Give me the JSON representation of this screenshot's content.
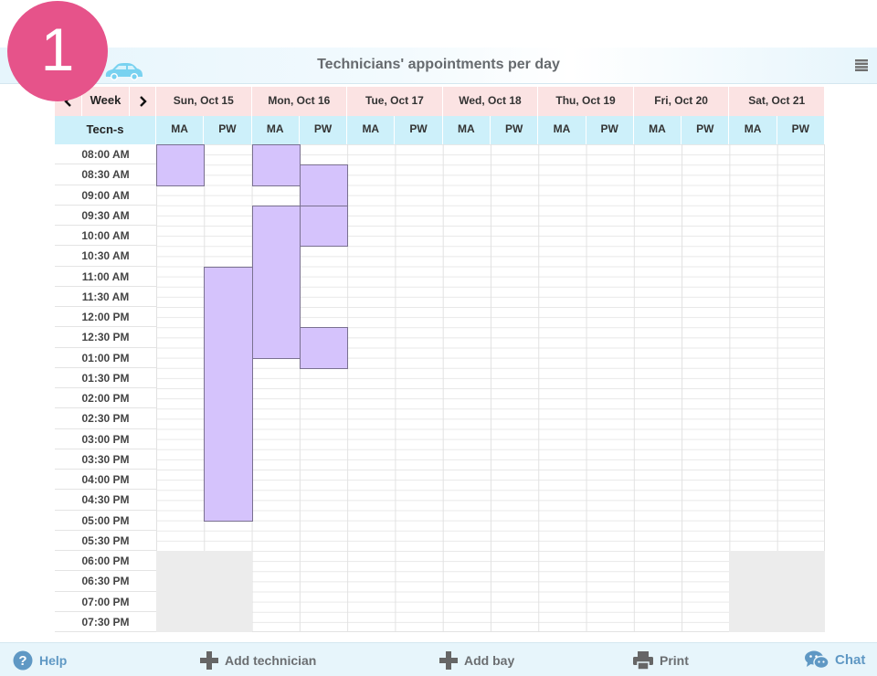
{
  "step_number": "1",
  "header": {
    "title": "Technicians' appointments per day",
    "logo_icon": "car-icon",
    "menu_icon": "menu-icon"
  },
  "calendar": {
    "week_label": "Week",
    "tech_label": "Tecn-s",
    "days": [
      {
        "label": "Sun, Oct 15",
        "techs": [
          "MA",
          "PW"
        ]
      },
      {
        "label": "Mon, Oct 16",
        "techs": [
          "MA",
          "PW"
        ]
      },
      {
        "label": "Tue, Oct 17",
        "techs": [
          "MA",
          "PW"
        ]
      },
      {
        "label": "Wed, Oct 18",
        "techs": [
          "MA",
          "PW"
        ]
      },
      {
        "label": "Thu, Oct 19",
        "techs": [
          "MA",
          "PW"
        ]
      },
      {
        "label": "Fri, Oct 20",
        "techs": [
          "MA",
          "PW"
        ]
      },
      {
        "label": "Sat, Oct 21",
        "techs": [
          "MA",
          "PW"
        ]
      }
    ],
    "times": [
      "08:00 AM",
      "08:30 AM",
      "09:00 AM",
      "09:30 AM",
      "10:00 AM",
      "10:30 AM",
      "11:00 AM",
      "11:30 AM",
      "12:00 PM",
      "12:30 PM",
      "01:00 PM",
      "01:30 PM",
      "02:00 PM",
      "02:30 PM",
      "03:00 PM",
      "03:30 PM",
      "04:00 PM",
      "04:30 PM",
      "05:00 PM",
      "05:30 PM",
      "06:00 PM",
      "06:30 PM",
      "07:00 PM",
      "07:30 PM"
    ],
    "closed": [
      {
        "day": 0,
        "from": 20,
        "to": 24
      },
      {
        "day": 6,
        "from": 20,
        "to": 24
      }
    ],
    "appointments": [
      {
        "day": 0,
        "tech": 0,
        "start": "08:00 AM",
        "end": "09:00 AM"
      },
      {
        "day": 0,
        "tech": 1,
        "start": "11:00 AM",
        "end": "05:15 PM"
      },
      {
        "day": 1,
        "tech": 0,
        "start": "08:00 AM",
        "end": "09:00 AM"
      },
      {
        "day": 1,
        "tech": 0,
        "start": "09:30 AM",
        "end": "01:15 PM"
      },
      {
        "day": 1,
        "tech": 1,
        "start": "08:30 AM",
        "end": "09:30 AM"
      },
      {
        "day": 1,
        "tech": 1,
        "start": "09:30 AM",
        "end": "10:30 AM"
      },
      {
        "day": 1,
        "tech": 1,
        "start": "12:30 PM",
        "end": "01:30 PM"
      }
    ],
    "appointment_color": "#d5c3fc"
  },
  "footer": {
    "help": "Help",
    "add_technician": "Add technician",
    "add_bay": "Add bay",
    "print": "Print",
    "chat": "Chat"
  }
}
